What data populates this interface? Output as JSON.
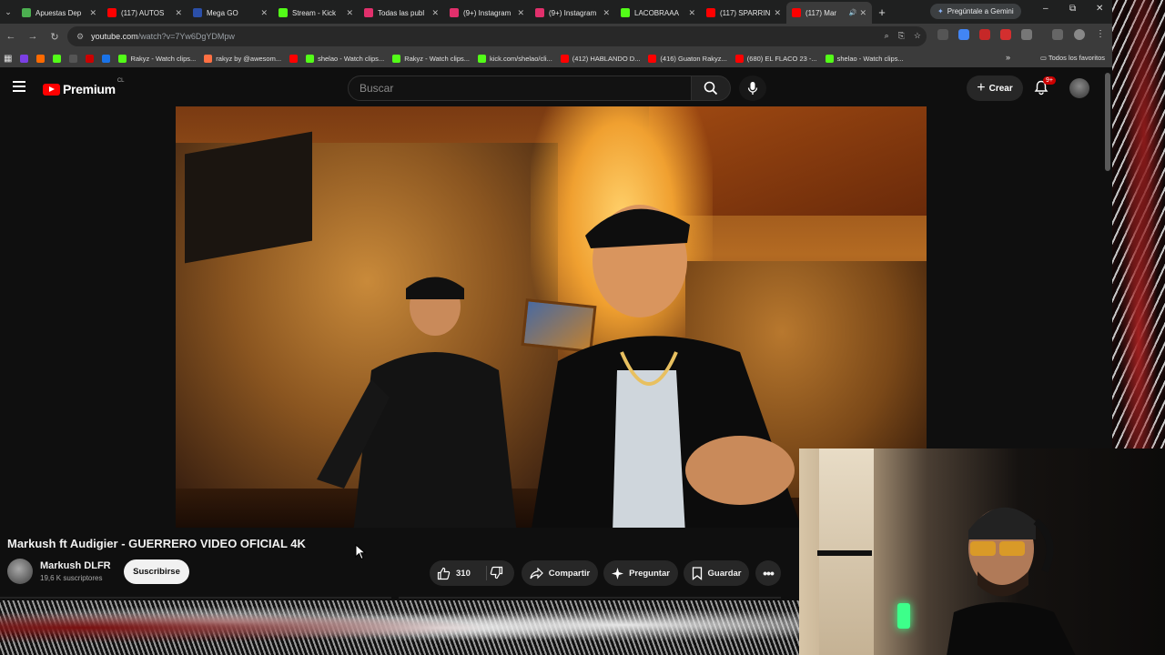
{
  "browser": {
    "tabs": [
      {
        "title": "Apuestas Dep",
        "fav_color": "#4caf50",
        "active": false
      },
      {
        "title": "(117) AUTOS",
        "fav_color": "#ff0000",
        "active": false
      },
      {
        "title": "Mega GO",
        "fav_color": "#2b4fa8",
        "active": false
      },
      {
        "title": "Stream - Kick",
        "fav_color": "#53fc18",
        "active": false
      },
      {
        "title": "Todas las publ",
        "fav_color": "#e1306c",
        "active": false
      },
      {
        "title": "(9+) Instagram",
        "fav_color": "#e1306c",
        "active": false
      },
      {
        "title": "(9+) Instagram",
        "fav_color": "#e1306c",
        "active": false
      },
      {
        "title": "LACOBRAAA",
        "fav_color": "#53fc18",
        "active": false
      },
      {
        "title": "(117) SPARRIN",
        "fav_color": "#ff0000",
        "active": false
      },
      {
        "title": "(117) Mar",
        "fav_color": "#ff0000",
        "active": true
      }
    ],
    "gemini_label": "Pregúntale a Gemini",
    "url_host": "youtube.com",
    "url_path": "/watch?v=7Yw6DgYDMpw",
    "bookmarks": [
      {
        "label": "",
        "color": "#7b3fe4"
      },
      {
        "label": "",
        "color": "#ff6a00"
      },
      {
        "label": "",
        "color": "#53fc18"
      },
      {
        "label": "",
        "color": "#555555"
      },
      {
        "label": "",
        "color": "#cc0000"
      },
      {
        "label": "",
        "color": "#1a73e8"
      },
      {
        "label": "Rakyz - Watch clips...",
        "color": "#53fc18"
      },
      {
        "label": "rakyz by @awesom...",
        "color": "#ff7043"
      },
      {
        "label": "",
        "color": "#ff0000"
      },
      {
        "label": "shelao - Watch clips...",
        "color": "#53fc18"
      },
      {
        "label": "Rakyz - Watch clips...",
        "color": "#53fc18"
      },
      {
        "label": "kick.com/shelao/cli...",
        "color": "#53fc18"
      },
      {
        "label": "(412) HABLANDO D...",
        "color": "#ff0000"
      },
      {
        "label": "(416) Guaton Rakyz...",
        "color": "#ff0000"
      },
      {
        "label": "(680) EL FLACO 23 -...",
        "color": "#ff0000"
      },
      {
        "label": "shelao - Watch clips...",
        "color": "#53fc18"
      }
    ],
    "all_bookmarks_label": "Todos los favoritos"
  },
  "youtube": {
    "logo_word": "Premium",
    "country_code": "CL",
    "search_placeholder": "Buscar",
    "create_label": "Crear",
    "notifications_badge": "9+",
    "video_title": "Markush ft Audigier - GUERRERO VIDEO OFICIAL 4K",
    "channel_name": "Markush DLFR",
    "subscribers": "19,6 K suscriptores",
    "subscribe_label": "Suscribirse",
    "likes": "310",
    "share_label": "Compartir",
    "ask_label": "Preguntar",
    "save_label": "Guardar",
    "brand_red": "#ff0000"
  }
}
